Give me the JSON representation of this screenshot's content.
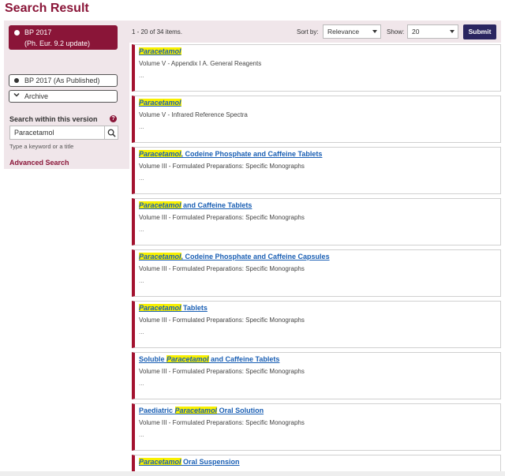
{
  "page": {
    "title": "Search Result"
  },
  "sidebar": {
    "versions": [
      {
        "line1": "BP 2017",
        "line2": "(Ph. Eur. 9.2 update)",
        "active": true
      },
      {
        "label": "BP 2017 (As Published)",
        "active": false
      }
    ],
    "archive_label": "Archive",
    "search_label": "Search within this version",
    "search_value": "Paracetamol",
    "search_hint": "Type a keyword or a title",
    "advanced_search": "Advanced Search"
  },
  "toolbar": {
    "item_count": "1 - 20 of 34 items.",
    "sort_label": "Sort by:",
    "sort_value": "Relevance",
    "show_label": "Show:",
    "show_value": "20",
    "submit_label": "Submit"
  },
  "results": [
    {
      "pre": "",
      "hl": "Paracetamol",
      "post": "",
      "volume": "Volume V - Appendix I A. General Reagents",
      "ellipsis": "..."
    },
    {
      "pre": "",
      "hl": "Paracetamol",
      "post": "",
      "volume": "Volume V - Infrared Reference Spectra",
      "ellipsis": "..."
    },
    {
      "pre": "",
      "hl": "Paracetamol",
      "post": ", Codeine Phosphate and Caffeine Tablets",
      "volume": "Volume III - Formulated Preparations: Specific Monographs",
      "ellipsis": "..."
    },
    {
      "pre": "",
      "hl": "Paracetamol",
      "post": " and Caffeine Tablets",
      "volume": "Volume III - Formulated Preparations: Specific Monographs",
      "ellipsis": "..."
    },
    {
      "pre": "",
      "hl": "Paracetamol",
      "post": ", Codeine Phosphate and Caffeine Capsules",
      "volume": "Volume III - Formulated Preparations: Specific Monographs",
      "ellipsis": "..."
    },
    {
      "pre": "",
      "hl": "Paracetamol",
      "post": " Tablets",
      "volume": "Volume III - Formulated Preparations: Specific Monographs",
      "ellipsis": "..."
    },
    {
      "pre": "Soluble ",
      "hl": "Paracetamol",
      "post": " and Caffeine Tablets",
      "volume": "Volume III - Formulated Preparations: Specific Monographs",
      "ellipsis": "..."
    },
    {
      "pre": "Paediatric ",
      "hl": "Paracetamol",
      "post": " Oral Solution",
      "volume": "Volume III - Formulated Preparations: Specific Monographs",
      "ellipsis": "..."
    },
    {
      "pre": "",
      "hl": "Paracetamol",
      "post": " Oral Suspension",
      "volume": "",
      "ellipsis": ""
    }
  ]
}
